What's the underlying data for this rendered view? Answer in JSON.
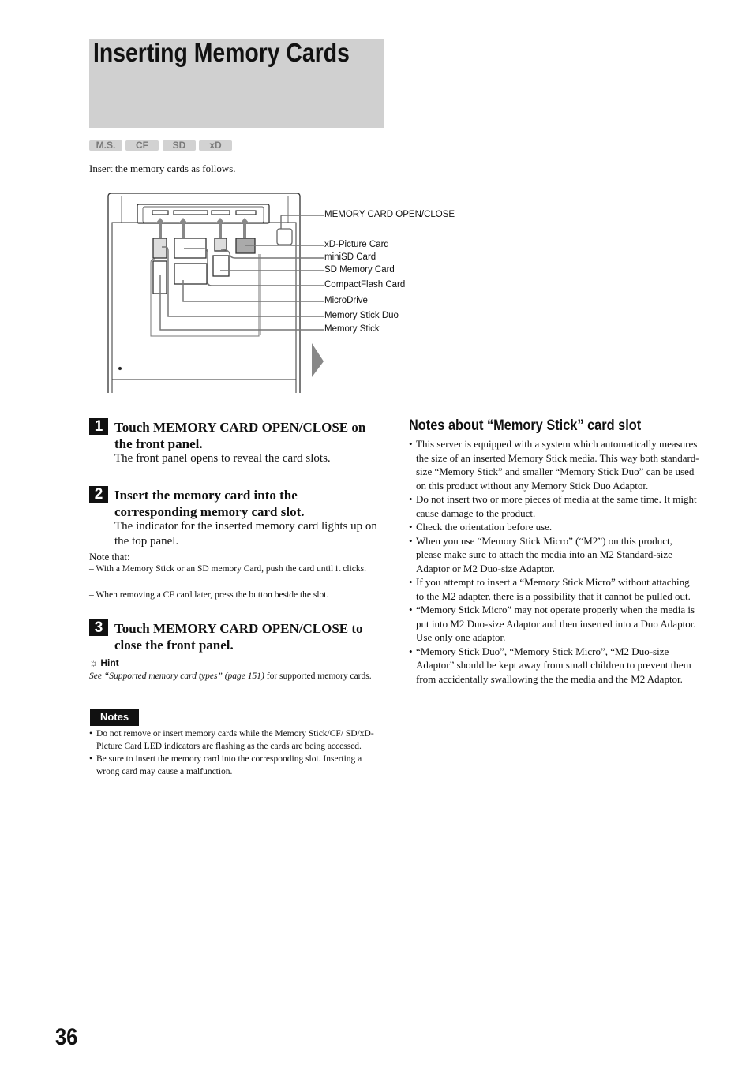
{
  "title": "Inserting Memory Cards",
  "tags": [
    "M.S.",
    "CF",
    "SD",
    "xD"
  ],
  "intro": "Insert the memory cards as follows.",
  "diagram": {
    "labels": [
      "MEMORY CARD OPEN/CLOSE",
      "xD-Picture Card",
      "miniSD Card",
      "SD Memory Card",
      "CompactFlash Card",
      "MicroDrive",
      "Memory Stick Duo",
      "Memory Stick"
    ]
  },
  "steps": [
    {
      "num": "1",
      "heading": "Touch MEMORY CARD OPEN/CLOSE on the front panel.",
      "body": "The front panel opens to reveal the card slots."
    },
    {
      "num": "2",
      "heading": "Insert the memory card into the corresponding memory card slot.",
      "body": "The indicator for the inserted memory card lights up on the top panel."
    },
    {
      "num": "3",
      "heading": "Touch MEMORY CARD OPEN/CLOSE to close the front panel.",
      "body": ""
    }
  ],
  "note_that": {
    "title": "Note that:",
    "items": [
      "– With a Memory Stick or an SD memory Card, push the card until it clicks.",
      "– When removing a CF card later, press the button beside the slot."
    ]
  },
  "hint": {
    "label": "Hint",
    "ref": "See “Supported memory card types” (page 151)",
    "rest": " for supported memory cards."
  },
  "notes": {
    "label": "Notes",
    "items": [
      "Do not remove or insert memory cards while the Memory Stick/CF/ SD/xD-Picture Card LED indicators are flashing as the cards are being accessed.",
      "Be sure to insert the memory card into the corresponding slot. Inserting a wrong card may cause a malfunction."
    ]
  },
  "ms_notes": {
    "heading": "Notes about “Memory Stick” card slot",
    "items": [
      "This server is equipped with a system which automatically measures the size of an inserted Memory Stick media. This way both standard-size “Memory Stick” and smaller “Memory Stick Duo” can be used on this product without any Memory Stick Duo Adaptor.",
      "Do not insert two or more pieces of media at the same time. It might cause damage to the product.",
      "Check the orientation before use.",
      "When you use “Memory Stick Micro” (“M2”)  on this product, please make sure to attach the media into an M2 Standard-size Adaptor or M2 Duo-size Adaptor.",
      "If you attempt to insert a “Memory Stick Micro” without attaching to the M2 adapter, there is a possibility that it cannot be pulled out.",
      "“Memory Stick Micro” may not operate properly when the media is put into M2 Duo-size Adaptor and then inserted into a Duo Adaptor. Use only one adaptor.",
      "“Memory Stick Duo”, “Memory Stick Micro”, “M2 Duo-size Adaptor” should be kept away from small children to prevent them from accidentally swallowing the the media and the M2 Adaptor."
    ]
  },
  "page_number": "36"
}
